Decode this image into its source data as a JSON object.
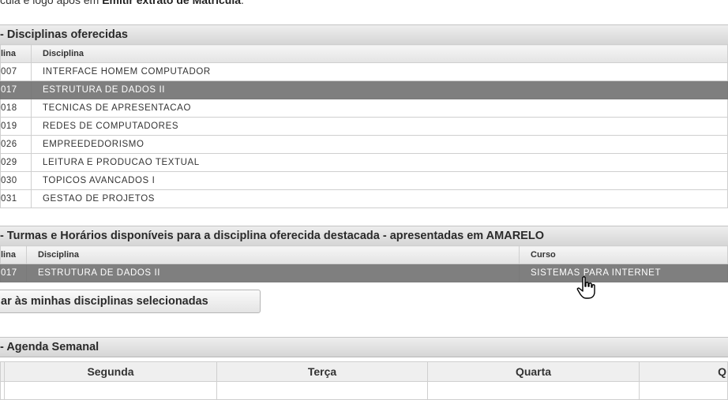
{
  "intro": {
    "prefix": "cula e logo após em ",
    "bold": "Emitir extrato de Matrícula",
    "suffix": "."
  },
  "section1": {
    "title": "- Disciplinas oferecidas"
  },
  "table1": {
    "headers": [
      "lina",
      "Disciplina"
    ],
    "rows": [
      {
        "code": "007",
        "name": "INTERFACE HOMEM COMPUTADOR"
      },
      {
        "code": "017",
        "name": "ESTRUTURA DE DADOS II"
      },
      {
        "code": "018",
        "name": "TECNICAS DE APRESENTACAO"
      },
      {
        "code": "019",
        "name": "REDES DE COMPUTADORES"
      },
      {
        "code": "026",
        "name": "EMPREEDEDORISMO"
      },
      {
        "code": "029",
        "name": "LEITURA E PRODUCAO TEXTUAL"
      },
      {
        "code": "030",
        "name": "TOPICOS AVANCADOS I"
      },
      {
        "code": "031",
        "name": "GESTAO DE PROJETOS"
      }
    ]
  },
  "section2": {
    "title": "- Turmas e Horários disponíveis para a disciplina oferecida destacada - apresentadas em AMARELO"
  },
  "table2": {
    "headers": [
      "lina",
      "Disciplina",
      "Curso"
    ],
    "row": {
      "code": "017",
      "name": "ESTRUTURA DE DADOS II",
      "course": "SISTEMAS PARA INTERNET"
    }
  },
  "button": {
    "label": "ar às minhas disciplinas selecionadas"
  },
  "section3": {
    "title": "- Agenda Semanal"
  },
  "agenda": {
    "days": [
      "Segunda",
      "Terça",
      "Quarta",
      "Q"
    ]
  },
  "colors": {
    "selected_row": "#7f7f7f",
    "header_bg": "#e0e0e0"
  },
  "icons": {
    "cursor": "hand-pointer-icon"
  }
}
